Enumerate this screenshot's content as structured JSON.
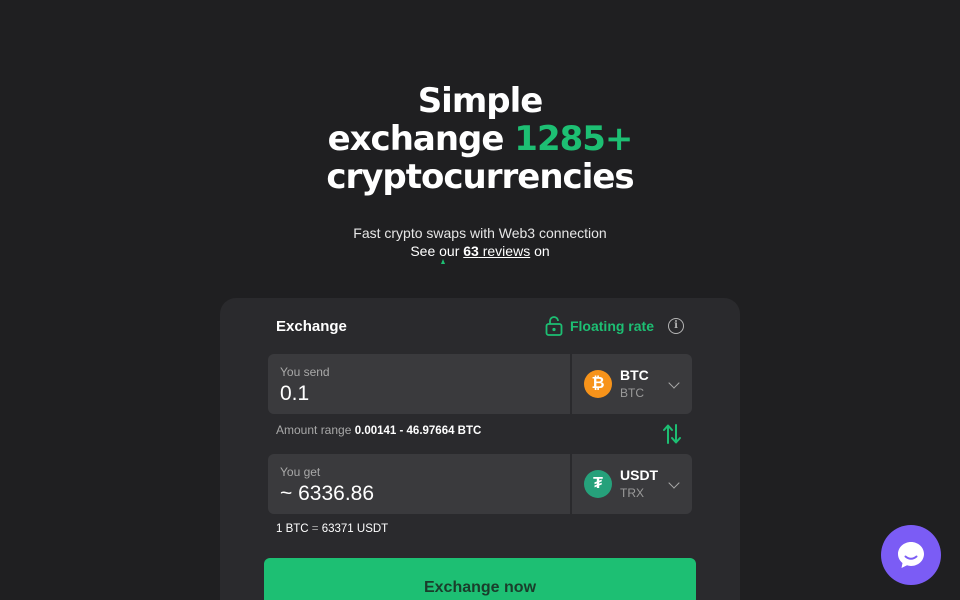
{
  "hero": {
    "title_line1": "Simple",
    "title_line2_prefix": "exchange ",
    "title_line2_accent": "1285+",
    "title_line3": "cryptocurrencies",
    "subtitle": "Fast crypto swaps with Web3 connection",
    "reviews_prefix": "See our ",
    "reviews_count": "63",
    "reviews_word": " reviews",
    "reviews_suffix": " on"
  },
  "exchange": {
    "title": "Exchange",
    "rate_mode": "Floating rate",
    "send": {
      "label": "You send",
      "value": "0.1",
      "currency_code": "BTC",
      "currency_network": "BTC",
      "coin_icon": "bitcoin-icon"
    },
    "range": {
      "label": "Amount range",
      "value": "0.00141 - 46.97664 BTC"
    },
    "get": {
      "label": "You get",
      "value": "~ 6336.86",
      "currency_code": "USDT",
      "currency_network": "TRX",
      "coin_icon": "tether-icon"
    },
    "rate_line": {
      "left": "1 BTC",
      "eq": "=",
      "right": "63371 USDT"
    },
    "cta_label": "Exchange now"
  },
  "colors": {
    "background": "#1f1f21",
    "card": "#2a2a2d",
    "accent": "#1dbf73",
    "chat": "#7b5cf5"
  }
}
